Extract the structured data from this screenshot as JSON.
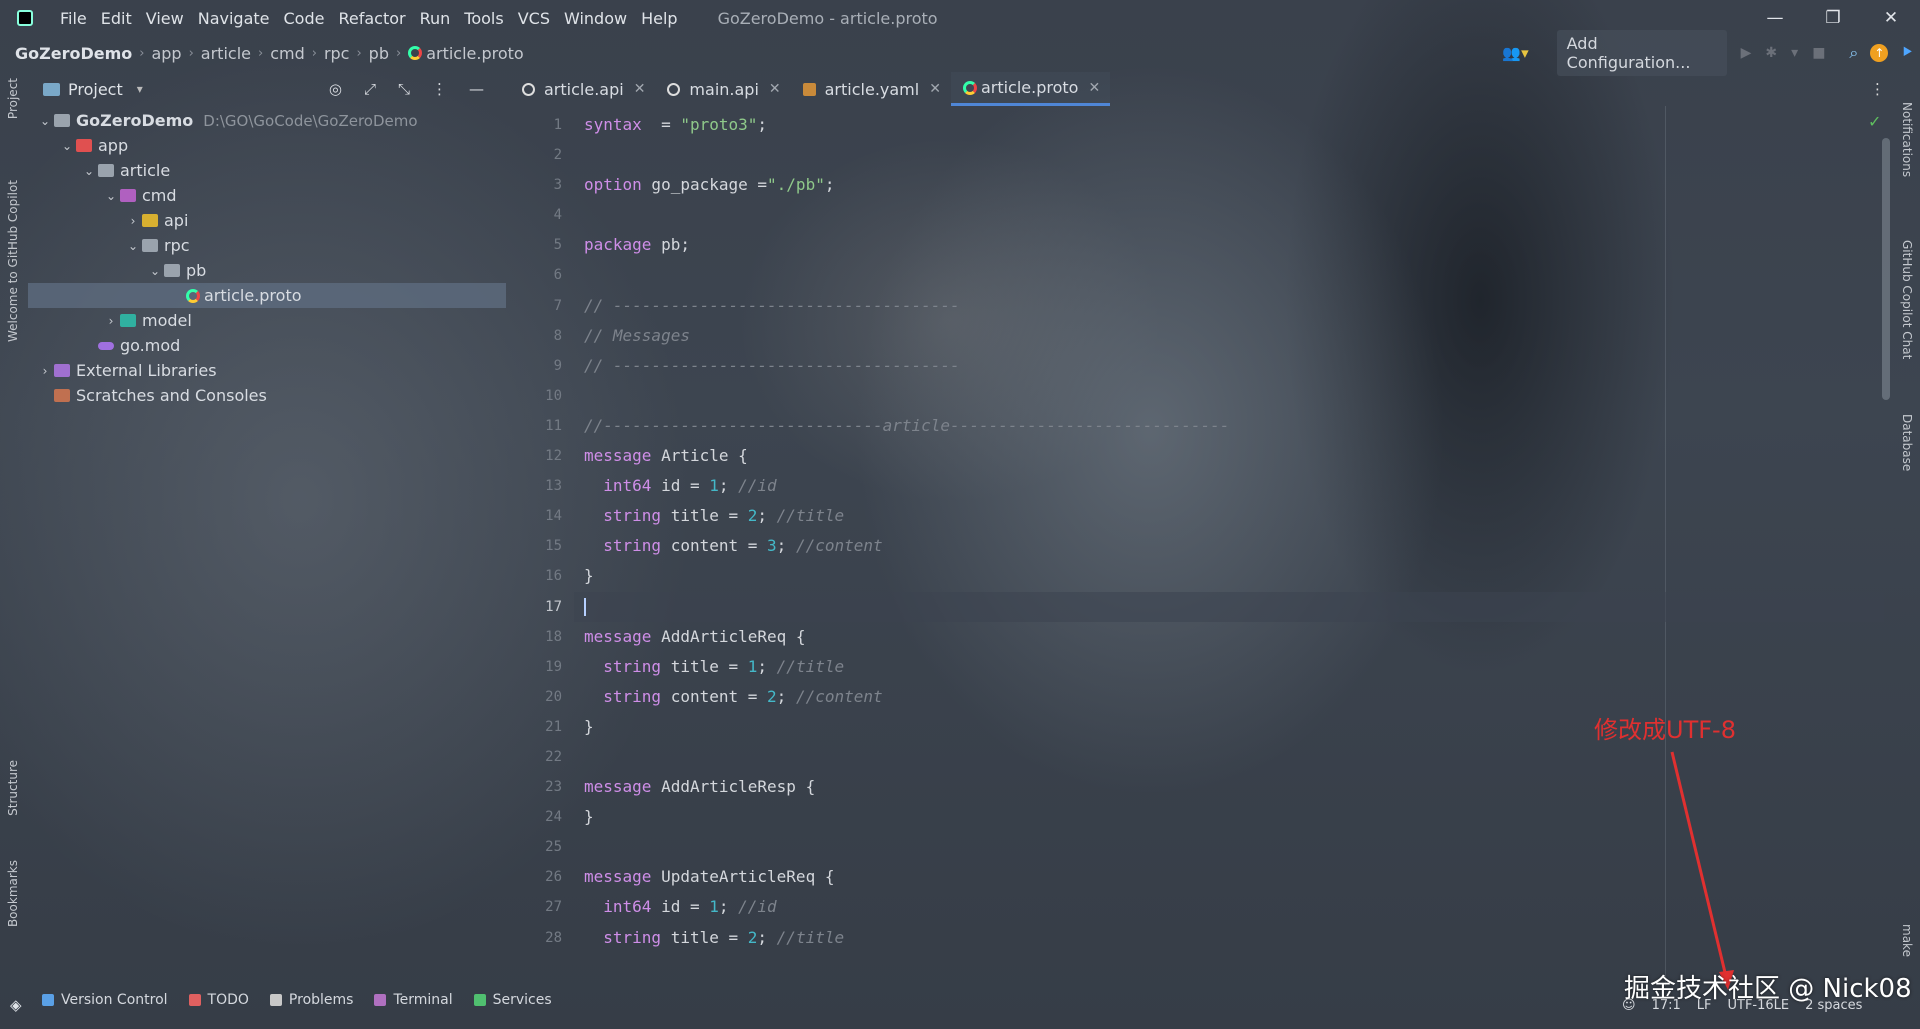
{
  "titlebar": {
    "menu": [
      "File",
      "Edit",
      "View",
      "Navigate",
      "Code",
      "Refactor",
      "Run",
      "Tools",
      "VCS",
      "Window",
      "Help"
    ],
    "window_title": "GoZeroDemo - article.proto",
    "controls": [
      "—",
      "❐",
      "✕"
    ]
  },
  "navbar": {
    "breadcrumb": [
      "GoZeroDemo",
      "app",
      "article",
      "cmd",
      "rpc",
      "pb",
      "article.proto"
    ],
    "add_configuration": "Add Configuration..."
  },
  "left_strip": {
    "project": "Project",
    "copilot": "Welcome to GitHub Copilot",
    "structure": "Structure",
    "bookmarks": "Bookmarks"
  },
  "project_panel": {
    "title": "Project",
    "tree": [
      {
        "label": "GoZeroDemo",
        "path": "D:\\GO\\GoCode\\GoZeroDemo",
        "depth": 0,
        "chevron": "v",
        "icon": "folder"
      },
      {
        "label": "app",
        "path": "",
        "depth": 1,
        "chevron": "v",
        "icon": "app"
      },
      {
        "label": "article",
        "path": "",
        "depth": 2,
        "chevron": "v",
        "icon": "folder"
      },
      {
        "label": "cmd",
        "path": "",
        "depth": 3,
        "chevron": "v",
        "icon": "cmd"
      },
      {
        "label": "api",
        "path": "",
        "depth": 4,
        "chevron": ">",
        "icon": "api"
      },
      {
        "label": "rpc",
        "path": "",
        "depth": 4,
        "chevron": "v",
        "icon": "folder"
      },
      {
        "label": "pb",
        "path": "",
        "depth": 5,
        "chevron": "v",
        "icon": "folder"
      },
      {
        "label": "article.proto",
        "path": "",
        "depth": 6,
        "chevron": "",
        "icon": "proto",
        "selected": true
      },
      {
        "label": "model",
        "path": "",
        "depth": 3,
        "chevron": ">",
        "icon": "model"
      },
      {
        "label": "go.mod",
        "path": "",
        "depth": 2,
        "chevron": "",
        "icon": "mod"
      },
      {
        "label": "External Libraries",
        "path": "",
        "depth": 0,
        "chevron": ">",
        "icon": "lib"
      },
      {
        "label": "Scratches and Consoles",
        "path": "",
        "depth": 0,
        "chevron": "",
        "icon": "scratch"
      }
    ]
  },
  "tabs": [
    {
      "label": "article.api",
      "icon": "api"
    },
    {
      "label": "main.api",
      "icon": "api"
    },
    {
      "label": "article.yaml",
      "icon": "yaml"
    },
    {
      "label": "article.proto",
      "icon": "proto",
      "active": true
    }
  ],
  "editor": {
    "current_line": 17,
    "lines": [
      {
        "n": 1,
        "code": [
          [
            "kw",
            "syntax"
          ],
          [
            "",
            "  = "
          ],
          [
            "str",
            "\"proto3\""
          ],
          [
            "",
            ";"
          ]
        ]
      },
      {
        "n": 2,
        "code": []
      },
      {
        "n": 3,
        "code": [
          [
            "kw",
            "option"
          ],
          [
            "",
            " go_package ="
          ],
          [
            "str",
            "\"./pb\""
          ],
          [
            "",
            ";"
          ]
        ]
      },
      {
        "n": 4,
        "code": []
      },
      {
        "n": 5,
        "code": [
          [
            "kw",
            "package"
          ],
          [
            "",
            " pb;"
          ]
        ]
      },
      {
        "n": 6,
        "code": []
      },
      {
        "n": 7,
        "code": [
          [
            "cmt",
            "// ------------------------------------"
          ]
        ]
      },
      {
        "n": 8,
        "code": [
          [
            "cmt",
            "// Messages"
          ]
        ]
      },
      {
        "n": 9,
        "code": [
          [
            "cmt",
            "// ------------------------------------"
          ]
        ]
      },
      {
        "n": 10,
        "code": []
      },
      {
        "n": 11,
        "code": [
          [
            "cmt",
            "//-----------------------------article-----------------------------"
          ]
        ]
      },
      {
        "n": 12,
        "code": [
          [
            "kw",
            "message"
          ],
          [
            "",
            " Article {"
          ]
        ]
      },
      {
        "n": 13,
        "code": [
          [
            "",
            "  "
          ],
          [
            "kw",
            "int64"
          ],
          [
            "",
            " id = "
          ],
          [
            "num",
            "1"
          ],
          [
            "",
            "; "
          ],
          [
            "cmt",
            "//id"
          ]
        ]
      },
      {
        "n": 14,
        "code": [
          [
            "",
            "  "
          ],
          [
            "kw",
            "string"
          ],
          [
            "",
            " title = "
          ],
          [
            "num",
            "2"
          ],
          [
            "",
            "; "
          ],
          [
            "cmt",
            "//title"
          ]
        ]
      },
      {
        "n": 15,
        "code": [
          [
            "",
            "  "
          ],
          [
            "kw",
            "string"
          ],
          [
            "",
            " content = "
          ],
          [
            "num",
            "3"
          ],
          [
            "",
            "; "
          ],
          [
            "cmt",
            "//content"
          ]
        ]
      },
      {
        "n": 16,
        "code": [
          [
            "",
            "}"
          ]
        ]
      },
      {
        "n": 17,
        "code": [],
        "cursor": true
      },
      {
        "n": 18,
        "code": [
          [
            "kw",
            "message"
          ],
          [
            "",
            " AddArticleReq {"
          ]
        ]
      },
      {
        "n": 19,
        "code": [
          [
            "",
            "  "
          ],
          [
            "kw",
            "string"
          ],
          [
            "",
            " title = "
          ],
          [
            "num",
            "1"
          ],
          [
            "",
            "; "
          ],
          [
            "cmt",
            "//title"
          ]
        ]
      },
      {
        "n": 20,
        "code": [
          [
            "",
            "  "
          ],
          [
            "kw",
            "string"
          ],
          [
            "",
            " content = "
          ],
          [
            "num",
            "2"
          ],
          [
            "",
            "; "
          ],
          [
            "cmt",
            "//content"
          ]
        ]
      },
      {
        "n": 21,
        "code": [
          [
            "",
            "}"
          ]
        ]
      },
      {
        "n": 22,
        "code": []
      },
      {
        "n": 23,
        "code": [
          [
            "kw",
            "message"
          ],
          [
            "",
            " AddArticleResp {"
          ]
        ]
      },
      {
        "n": 24,
        "code": [
          [
            "",
            "}"
          ]
        ]
      },
      {
        "n": 25,
        "code": []
      },
      {
        "n": 26,
        "code": [
          [
            "kw",
            "message"
          ],
          [
            "",
            " UpdateArticleReq {"
          ]
        ]
      },
      {
        "n": 27,
        "code": [
          [
            "",
            "  "
          ],
          [
            "kw",
            "int64"
          ],
          [
            "",
            " id = "
          ],
          [
            "num",
            "1"
          ],
          [
            "",
            "; "
          ],
          [
            "cmt",
            "//id"
          ]
        ]
      },
      {
        "n": 28,
        "code": [
          [
            "",
            "  "
          ],
          [
            "kw",
            "string"
          ],
          [
            "",
            " title = "
          ],
          [
            "num",
            "2"
          ],
          [
            "",
            "; "
          ],
          [
            "cmt",
            "//title"
          ]
        ]
      }
    ]
  },
  "right_strip": {
    "notifications": "Notifications",
    "copilot_chat": "GitHub Copilot Chat",
    "database": "Database",
    "make": "make"
  },
  "bottom_tools": [
    {
      "label": "Version Control",
      "color": "#5aa0e6"
    },
    {
      "label": "TODO",
      "color": "#e06060"
    },
    {
      "label": "Problems",
      "color": "#c8c8c8"
    },
    {
      "label": "Terminal",
      "color": "#b070c0"
    },
    {
      "label": "Services",
      "color": "#50c070"
    }
  ],
  "status": {
    "position": "17:1",
    "line_sep": "LF",
    "encoding": "UTF-16LE",
    "indent": "2 spaces"
  },
  "annotation": {
    "text": "修改成UTF-8",
    "color": "#e03030"
  },
  "watermark": "掘金技术社区 @ Nick08"
}
